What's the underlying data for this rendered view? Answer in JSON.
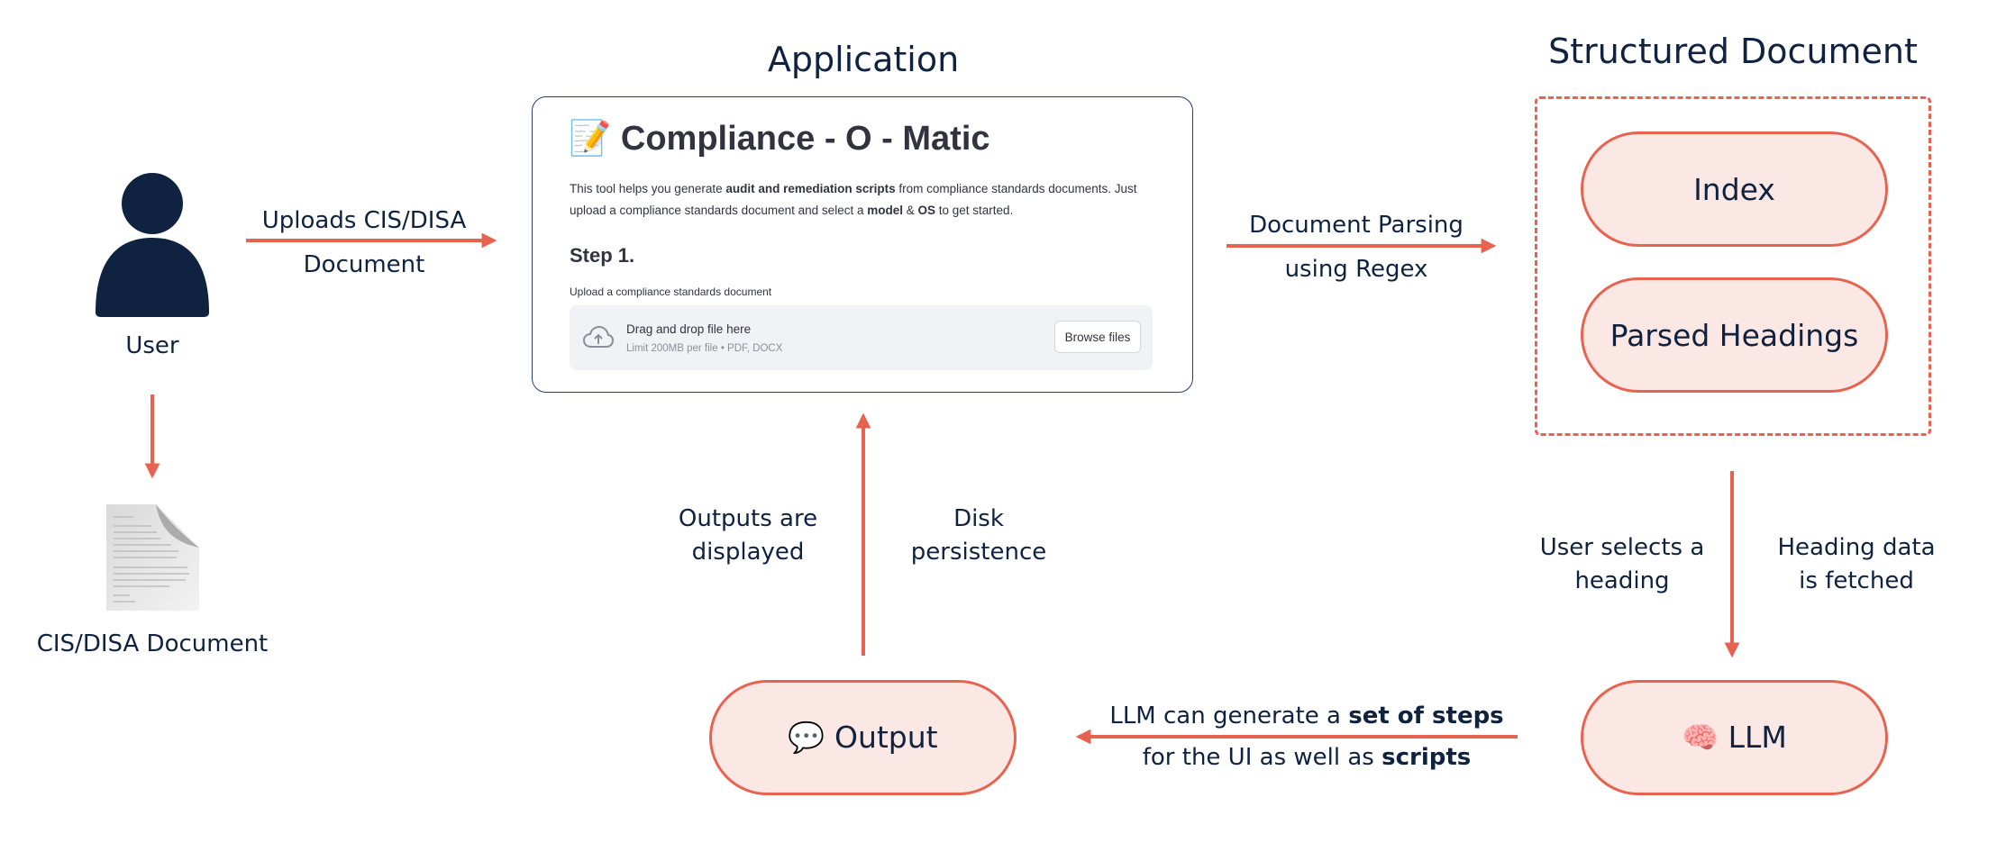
{
  "titles": {
    "application": "Application",
    "structured_document": "Structured Document"
  },
  "user": {
    "label": "User"
  },
  "document_icon": {
    "label": "CIS/DISA Document"
  },
  "edges": {
    "upload_line1": "Uploads CIS/DISA",
    "upload_line2": "Document",
    "parsing_line1": "Document Parsing",
    "parsing_line2": "using Regex",
    "selects_line1": "User selects a",
    "selects_line2": "heading",
    "fetched_line1": "Heading data",
    "fetched_line2": "is fetched",
    "llm_out_line1_a": "LLM can generate a ",
    "llm_out_line1_b": "set of steps",
    "llm_out_line2_a": "for the UI as well as ",
    "llm_out_line2_b": "scripts",
    "displayed_line1": "Outputs are",
    "displayed_line2": "displayed",
    "disk_line1": "Disk",
    "disk_line2": "persistence"
  },
  "app_screenshot": {
    "heading_emoji": "📝",
    "heading": "Compliance - O - Matic",
    "desc_1": "This tool helps you generate ",
    "desc_2": "audit and remediation scripts",
    "desc_3": " from compliance standards documents. Just upload a compliance standards document and select a ",
    "desc_4": "model",
    "desc_5": " & ",
    "desc_6": "OS",
    "desc_7": " to get started.",
    "step": "Step 1.",
    "upload_label": "Upload a compliance standards document",
    "dropzone_title": "Drag and drop file here",
    "dropzone_sub": "Limit 200MB per file • PDF, DOCX",
    "browse_button": "Browse files"
  },
  "nodes": {
    "index": "Index",
    "parsed_headings": "Parsed Headings",
    "llm": "🧠 LLM",
    "output": "💬 Output"
  },
  "colors": {
    "accent": "#e8634f",
    "node_fill": "#fbe7e4",
    "text": "#0f2240"
  }
}
